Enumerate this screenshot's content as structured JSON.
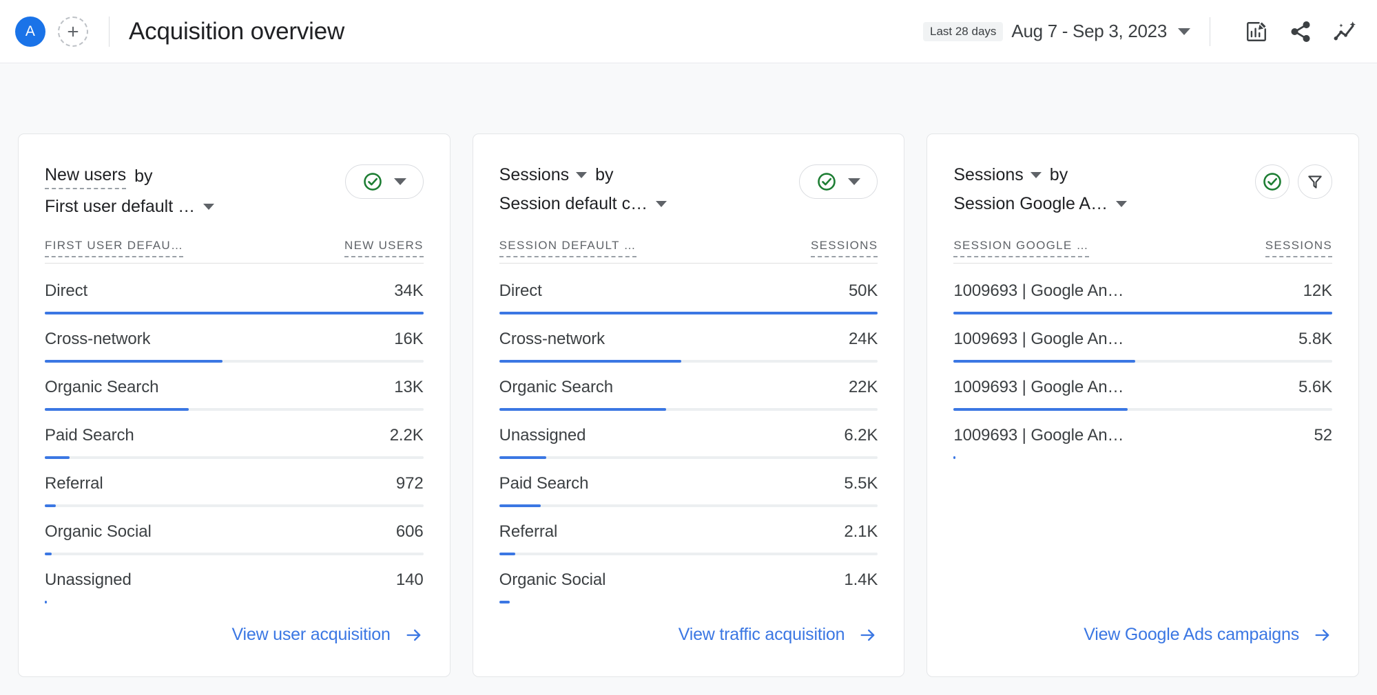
{
  "header": {
    "avatar_letter": "A",
    "add_icon": "plus-circle-icon",
    "title": "Acquisition overview",
    "date_chip": "Last 28 days",
    "date_range": "Aug 7 - Sep 3, 2023",
    "icons": [
      "edit-report-icon",
      "share-icon",
      "insights-icon"
    ]
  },
  "cards": [
    {
      "metric": "New users",
      "metric_has_caret": false,
      "by": "by",
      "dimension": "First user default …",
      "actions": [
        "check-circle-icon",
        "chevron-down-icon"
      ],
      "action_style": "pill",
      "col_dimension": "FIRST USER DEFAU…",
      "col_metric": "NEW USERS",
      "footer_label": "View user acquisition",
      "rows": [
        {
          "label": "Direct",
          "value": "34K",
          "pct": 100
        },
        {
          "label": "Cross-network",
          "value": "16K",
          "pct": 47
        },
        {
          "label": "Organic Search",
          "value": "13K",
          "pct": 38
        },
        {
          "label": "Paid Search",
          "value": "2.2K",
          "pct": 6.5
        },
        {
          "label": "Referral",
          "value": "972",
          "pct": 2.9
        },
        {
          "label": "Organic Social",
          "value": "606",
          "pct": 1.8
        },
        {
          "label": "Unassigned",
          "value": "140",
          "pct": 0.5
        }
      ]
    },
    {
      "metric": "Sessions",
      "metric_has_caret": true,
      "by": "by",
      "dimension": "Session default c…",
      "actions": [
        "check-circle-icon",
        "chevron-down-icon"
      ],
      "action_style": "pill",
      "col_dimension": "SESSION DEFAULT …",
      "col_metric": "SESSIONS",
      "footer_label": "View traffic acquisition",
      "rows": [
        {
          "label": "Direct",
          "value": "50K",
          "pct": 100
        },
        {
          "label": "Cross-network",
          "value": "24K",
          "pct": 48
        },
        {
          "label": "Organic Search",
          "value": "22K",
          "pct": 44
        },
        {
          "label": "Unassigned",
          "value": "6.2K",
          "pct": 12.4
        },
        {
          "label": "Paid Search",
          "value": "5.5K",
          "pct": 11
        },
        {
          "label": "Referral",
          "value": "2.1K",
          "pct": 4.2
        },
        {
          "label": "Organic Social",
          "value": "1.4K",
          "pct": 2.8
        }
      ]
    },
    {
      "metric": "Sessions",
      "metric_has_caret": true,
      "by": "by",
      "dimension": "Session Google A…",
      "actions": [
        "check-circle-icon",
        "filter-icon"
      ],
      "action_style": "circles",
      "col_dimension": "SESSION GOOGLE …",
      "col_metric": "SESSIONS",
      "footer_label": "View Google Ads campaigns",
      "rows": [
        {
          "label": "1009693 | Google An…",
          "value": "12K",
          "pct": 100
        },
        {
          "label": "1009693 | Google An…",
          "value": "5.8K",
          "pct": 48
        },
        {
          "label": "1009693 | Google An…",
          "value": "5.6K",
          "pct": 46
        },
        {
          "label": "1009693 | Google An…",
          "value": "52",
          "pct": 0.45
        }
      ]
    }
  ],
  "colors": {
    "accent_blue": "#3b77e3",
    "link_blue": "#3b77e3",
    "avatar_blue": "#1a73e8",
    "check_green": "#1e7e34",
    "page_bg": "#f8f9fa",
    "card_bg": "#ffffff"
  }
}
